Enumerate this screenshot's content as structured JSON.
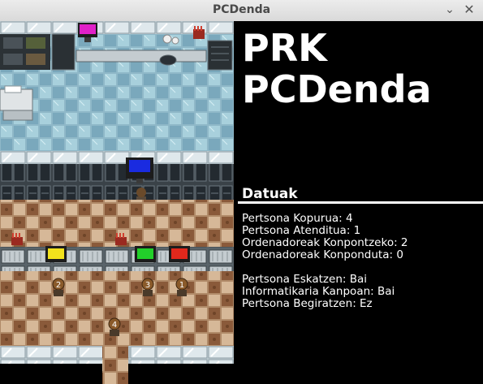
{
  "window": {
    "title": "PCDenda",
    "minimize_glyph": "⌄",
    "close_glyph": "✕"
  },
  "panel": {
    "logo_line1": "PRK",
    "logo_line2": "PCDenda",
    "section_title": "Datuak",
    "stats_group1": [
      {
        "label": "Pertsona Kopurua",
        "value": "4"
      },
      {
        "label": "Pertsona Atenditua",
        "value": "1"
      },
      {
        "label": "Ordenadoreak Konpontzeko",
        "value": "2"
      },
      {
        "label": "Ordenadoreak Konponduta",
        "value": "0"
      }
    ],
    "stats_group2": [
      {
        "label": "Pertsona Eskatzen",
        "value": "Bai"
      },
      {
        "label": "Informatikaria Kanpoan",
        "value": "Bai"
      },
      {
        "label": "Pertsona Begiratzen",
        "value": "Ez"
      }
    ]
  },
  "scene": {
    "monitors": [
      {
        "name": "top-counter-monitor",
        "color": "#e020c8"
      },
      {
        "name": "technician-monitor",
        "color": "#1a2be0"
      },
      {
        "name": "yellow-monitor",
        "color": "#f2e21c"
      },
      {
        "name": "green-monitor",
        "color": "#22d02a"
      },
      {
        "name": "red-monitor",
        "color": "#e0281c"
      }
    ],
    "customers": [
      {
        "number": "2"
      },
      {
        "number": "3"
      },
      {
        "number": "1"
      },
      {
        "number": "4"
      }
    ]
  }
}
